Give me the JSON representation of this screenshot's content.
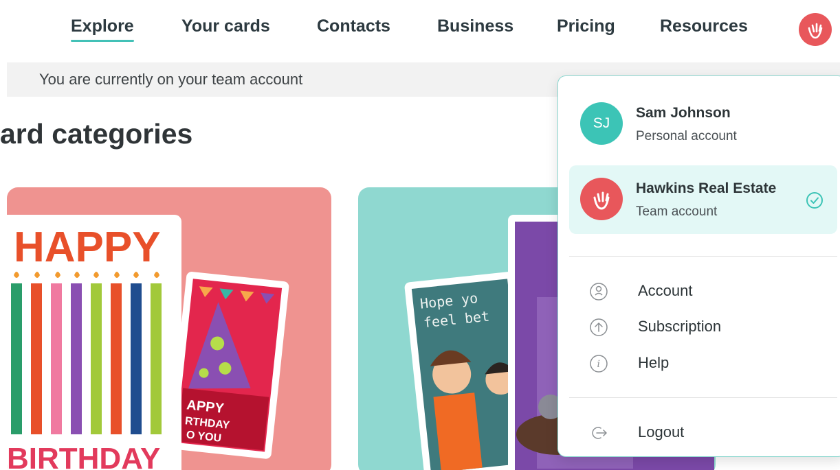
{
  "nav": {
    "items": [
      {
        "label": "Explore",
        "active": true
      },
      {
        "label": "Your cards"
      },
      {
        "label": "Contacts"
      },
      {
        "label": "Business"
      },
      {
        "label": "Pricing"
      },
      {
        "label": "Resources"
      }
    ],
    "avatar_icon": "wave-hand-icon",
    "accent_color": "#43c1b7",
    "avatar_color": "#e8575b"
  },
  "banner": {
    "text": "You are currently on your team account"
  },
  "main": {
    "heading": "ard categories",
    "tiles": [
      {
        "name": "birthday",
        "card_texts": [
          "HAPPY",
          "BIRTHDAY",
          "APPY",
          "RTHDAY",
          "O YOU"
        ]
      },
      {
        "name": "get-well",
        "card_texts": [
          "Hope yo",
          "feel bet"
        ]
      }
    ]
  },
  "dropdown": {
    "accounts": [
      {
        "initials": "SJ",
        "name": "Sam Johnson",
        "type": "Personal account",
        "active": false
      },
      {
        "name": "Hawkins Real Estate",
        "type": "Team account",
        "active": true
      }
    ],
    "menu": [
      {
        "label": "Account",
        "icon": "user-circle-icon"
      },
      {
        "label": "Subscription",
        "icon": "arrow-up-circle-icon"
      },
      {
        "label": "Help",
        "icon": "info-circle-icon"
      }
    ],
    "logout": {
      "label": "Logout",
      "icon": "logout-icon"
    }
  }
}
